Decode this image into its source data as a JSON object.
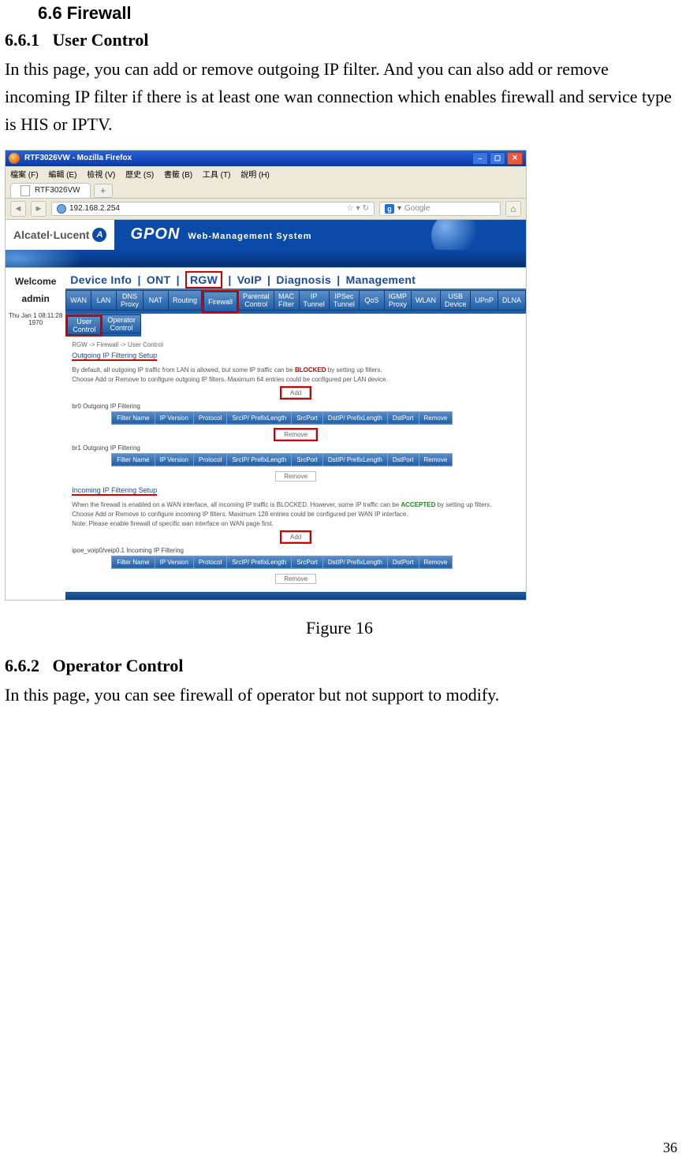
{
  "doc": {
    "section": "6.6    Firewall",
    "sub1_num": "6.6.1",
    "sub1_title": "User Control",
    "para1": "In this page, you can add or remove outgoing IP filter. And you can also add or remove incoming IP filter if there is at least one wan connection which enables firewall and service type is HIS or IPTV.",
    "fig_caption": "Figure 16",
    "sub2_num": "6.6.2",
    "sub2_title": "Operator Control",
    "para2": "In this page, you can see firewall of operator but not support to modify.",
    "page_num": "36"
  },
  "ff": {
    "title": "RTF3026VW - Mozilla Firefox",
    "menus": [
      "檔案 (F)",
      "編輯 (E)",
      "檢視 (V)",
      "歷史 (S)",
      "書籤 (B)",
      "工具 (T)",
      "說明 (H)"
    ],
    "tab_label": "RTF3026VW",
    "url": "192.168.2.254",
    "search_placeholder": "Google"
  },
  "gpon": {
    "brand": "Alcatel·Lucent",
    "title_big": "GPON",
    "title_sub": "Web-Management System"
  },
  "sidebar": {
    "welcome": "Welcome",
    "user": "admin",
    "timestamp": "Thu Jan 1 08:11:28 1970"
  },
  "tabs": {
    "items": [
      "Device Info",
      "ONT",
      "RGW",
      "VoIP",
      "Diagnosis",
      "Management"
    ],
    "active_index": 2
  },
  "nav1": [
    "WAN",
    "LAN",
    "DNS\nProxy",
    "NAT",
    "Routing",
    "Firewall",
    "Parental\nControl",
    "MAC\nFilter",
    "IP\nTunnel",
    "IPSec\nTunnel",
    "QoS",
    "IGMP\nProxy",
    "WLAN",
    "USB\nDevice",
    "UPnP",
    "DLNA"
  ],
  "nav1_active_index": 5,
  "nav2": [
    "User\nControl",
    "Operator\nControl"
  ],
  "nav2_active_index": 0,
  "content": {
    "breadcrumb": "RGW -> Firewall -> User Control",
    "outgoing_title": "Outgoing IP Filtering Setup",
    "out_desc1a": "By default, all outgoing IP traffic from LAN is allowed, but some IP traffic can be ",
    "out_desc1_red": "BLOCKED",
    "out_desc1b": " by setting up filters.",
    "out_desc2": "Choose Add or Remove to configure outgoing IP filters. Maximum 64 entries could be configured per LAN device.",
    "add_label": "Add",
    "remove_label": "Remove",
    "table_headers": [
      "Filter Name",
      "IP Version",
      "Protocol",
      "SrcIP/ PrefixLength",
      "SrcPort",
      "DstIP/ PrefixLength",
      "DstPort",
      "Remove"
    ],
    "out_table1_caption": "br0 Outgoing IP Filtering",
    "out_table2_caption": "br1 Outgoing IP Filtering",
    "incoming_title": "Incoming IP Filtering Setup",
    "in_desc1a": "When the firewall is enabled on a WAN interface, all incoming IP traffic is BLOCKED. However, some IP traffic can be ",
    "in_desc1_green": "ACCEPTED",
    "in_desc1b": " by setting up filters.",
    "in_desc2": "Choose Add or Remove to configure incoming IP filters. Maximum 128 entries could be configured per WAN IP interface.",
    "in_desc3": "Note: Please enable firewall of specific wan interface on WAN page first.",
    "in_table1_caption": "ipoe_voip0/veip0.1 Incoming IP Filtering"
  }
}
